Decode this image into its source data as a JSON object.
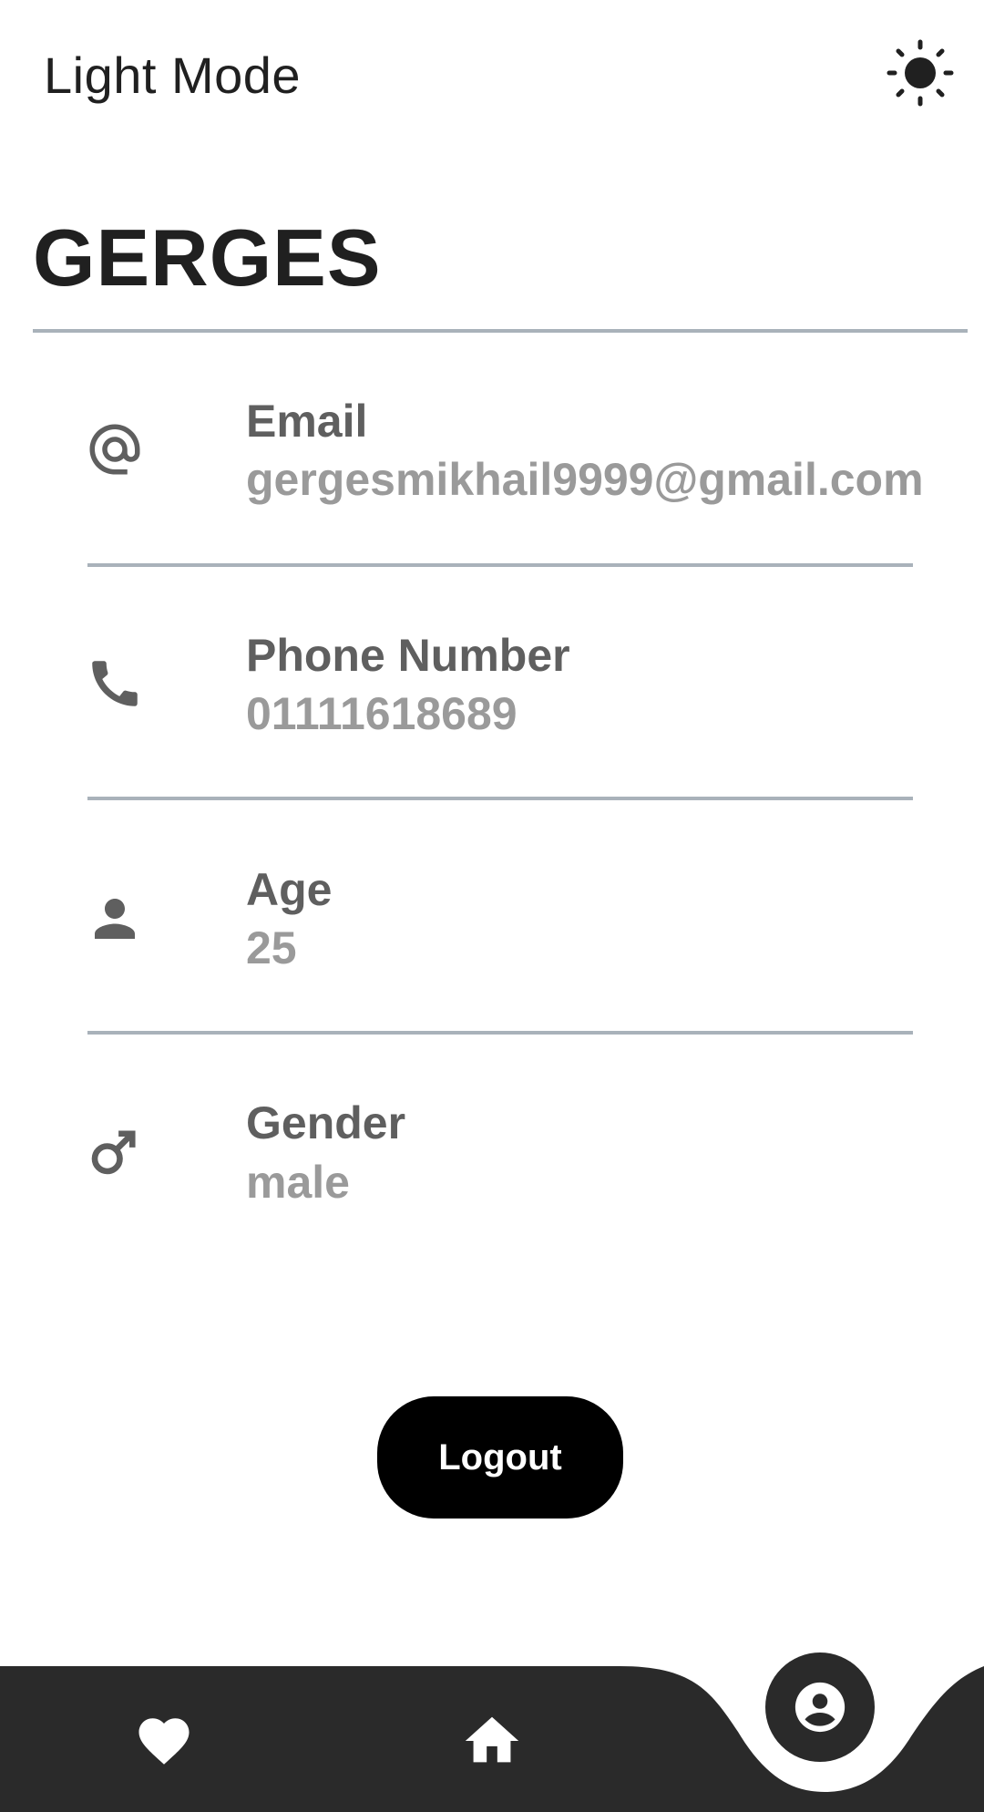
{
  "app": {
    "mode_label": "Light Mode"
  },
  "theme_toggle": {
    "icon": "sun-icon"
  },
  "profile": {
    "name": "GERGES",
    "fields": [
      {
        "label": "Email",
        "value": "gergesmikhail9999@gmail.com",
        "icon": "at-icon"
      },
      {
        "label": "Phone Number",
        "value": "01111618689",
        "icon": "phone-icon"
      },
      {
        "label": "Age",
        "value": "25",
        "icon": "person-icon"
      },
      {
        "label": "Gender",
        "value": "male",
        "icon": "male-icon"
      }
    ]
  },
  "actions": {
    "logout_label": "Logout"
  },
  "nav": {
    "items": [
      {
        "icon": "heart-icon"
      },
      {
        "icon": "home-icon"
      },
      {
        "icon": "profile-icon",
        "active": true
      }
    ]
  },
  "colors": {
    "text_primary": "#202020",
    "label_gray": "#5f5f5f",
    "value_gray": "#9a9a9a",
    "divider": "#a9b2ba",
    "nav_background": "#2a2a2a",
    "button_background": "#000000"
  }
}
